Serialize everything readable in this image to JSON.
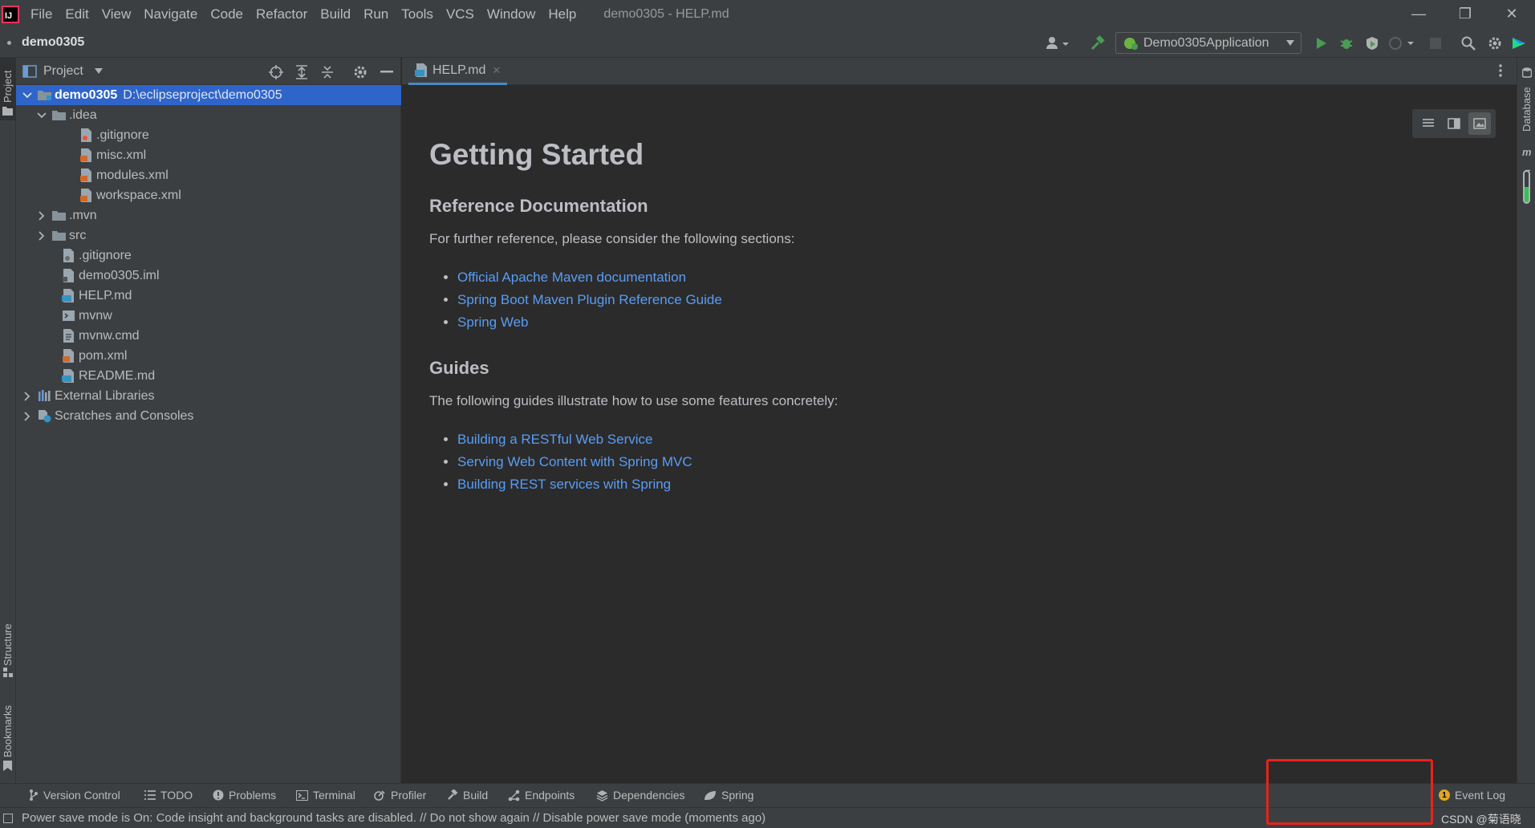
{
  "menu": {
    "logo_text": "IJ",
    "items": [
      "File",
      "Edit",
      "View",
      "Navigate",
      "Code",
      "Refactor",
      "Build",
      "Run",
      "Tools",
      "VCS",
      "Window",
      "Help"
    ],
    "window_title": "demo0305 - HELP.md"
  },
  "window_controls": {
    "minimize": "—",
    "restore": "❐",
    "close": "✕"
  },
  "navbar": {
    "project_name": "demo0305",
    "run_config": "Demo0305Application"
  },
  "left_strip": {
    "project": "Project",
    "structure": "Structure",
    "bookmarks": "Bookmarks"
  },
  "right_strip": {
    "database": "Database",
    "maven": "Maven"
  },
  "project_panel": {
    "title": "Project",
    "tree": [
      {
        "label": "demo0305",
        "path": "D:\\eclipseproject\\demo0305"
      },
      {
        "label": ".idea"
      },
      {
        "label": ".gitignore"
      },
      {
        "label": "misc.xml"
      },
      {
        "label": "modules.xml"
      },
      {
        "label": "workspace.xml"
      },
      {
        "label": ".mvn"
      },
      {
        "label": "src"
      },
      {
        "label": ".gitignore"
      },
      {
        "label": "demo0305.iml"
      },
      {
        "label": "HELP.md"
      },
      {
        "label": "mvnw"
      },
      {
        "label": "mvnw.cmd"
      },
      {
        "label": "pom.xml"
      },
      {
        "label": "README.md"
      },
      {
        "label": "External Libraries"
      },
      {
        "label": "Scratches and Consoles"
      }
    ]
  },
  "editor": {
    "tab_label": "HELP.md",
    "md_badge": "MD",
    "h1": "Getting Started",
    "ref_heading": "Reference Documentation",
    "ref_para": "For further reference, please consider the following sections:",
    "ref_links": [
      "Official Apache Maven documentation",
      "Spring Boot Maven Plugin Reference Guide",
      "Spring Web"
    ],
    "guides_heading": "Guides",
    "guides_para": "The following guides illustrate how to use some features concretely:",
    "guide_links": [
      "Building a RESTful Web Service",
      "Serving Web Content with Spring MVC",
      "Building REST services with Spring"
    ]
  },
  "tool_windows": [
    "Version Control",
    "TODO",
    "Problems",
    "Terminal",
    "Profiler",
    "Build",
    "Endpoints",
    "Dependencies",
    "Spring"
  ],
  "event_log": {
    "label": "Event Log",
    "count": "1"
  },
  "status": {
    "message": "Power save mode is On: Code insight and background tasks are disabled. // Do not show again // Disable power save mode (moments ago)",
    "watermark": "CSDN @菊语晓"
  },
  "colors": {
    "accent": "#2f65ca",
    "link": "#589df6",
    "highlight_box": "#e8231b",
    "run_green": "#499c54"
  }
}
